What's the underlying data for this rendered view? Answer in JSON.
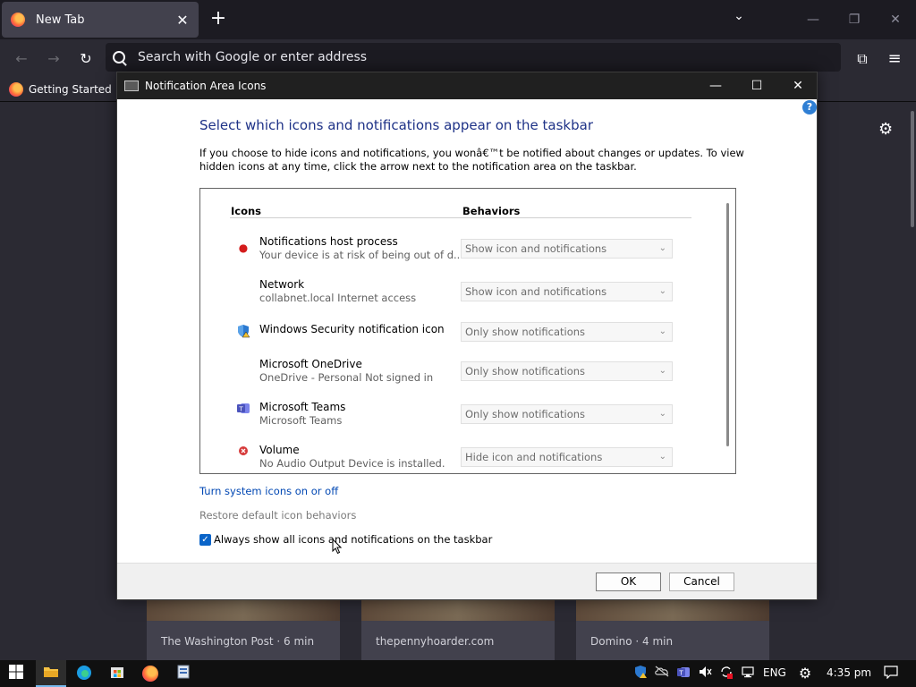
{
  "browser": {
    "tab_title": "New Tab",
    "tab_close": "✕",
    "new_tab": "+",
    "tab_list": "⌄",
    "minimize": "—",
    "restore": "❐",
    "close": "✕",
    "back": "←",
    "forward": "→",
    "reload": "↻",
    "search_placeholder": "Search with Google or enter address",
    "extensions_icon": "⧉",
    "menu_icon": "≡",
    "bookmark_label": "Getting Started"
  },
  "newtab": {
    "cards": [
      {
        "source": "The Washington Post · 6 min"
      },
      {
        "source": "thepennyhoarder.com"
      },
      {
        "source": "Domino · 4 min"
      }
    ]
  },
  "dialog": {
    "title": "Notification Area Icons",
    "minimize": "—",
    "maximize": "☐",
    "close": "✕",
    "help": "?",
    "heading": "Select which icons and notifications appear on the taskbar",
    "description": "If you choose to hide icons and notifications, you wonâ€™t be notified about changes or updates. To view hidden icons at any time, click the arrow next to the notification area on the taskbar.",
    "col_icons": "Icons",
    "col_behaviors": "Behaviors",
    "rows": [
      {
        "name": "Notifications host process",
        "sub": "Your device is at risk of being out of d...",
        "behavior": "Show icon and notifications",
        "icon": "red-dot-icon"
      },
      {
        "name": "Network",
        "sub": "collabnet.local Internet access",
        "behavior": "Show icon and notifications",
        "icon": ""
      },
      {
        "name": "Windows Security notification icon",
        "sub": "",
        "behavior": "Only show notifications",
        "icon": "shield-warning-icon"
      },
      {
        "name": "Microsoft OneDrive",
        "sub": "OneDrive - Personal Not signed in",
        "behavior": "Only show notifications",
        "icon": ""
      },
      {
        "name": "Microsoft Teams",
        "sub": "Microsoft Teams",
        "behavior": "Only show notifications",
        "icon": "teams-icon"
      },
      {
        "name": "Volume",
        "sub": "No Audio Output Device is installed.",
        "behavior": "Hide icon and notifications",
        "icon": "volume-error-icon"
      }
    ],
    "link_system_icons": "Turn system icons on or off",
    "link_restore": "Restore default icon behaviors",
    "checkbox_label": "Always show all icons and notifications on the taskbar",
    "checkbox_checked": true,
    "ok": "OK",
    "cancel": "Cancel"
  },
  "taskbar": {
    "language": "ENG",
    "time": "4:35 pm"
  }
}
